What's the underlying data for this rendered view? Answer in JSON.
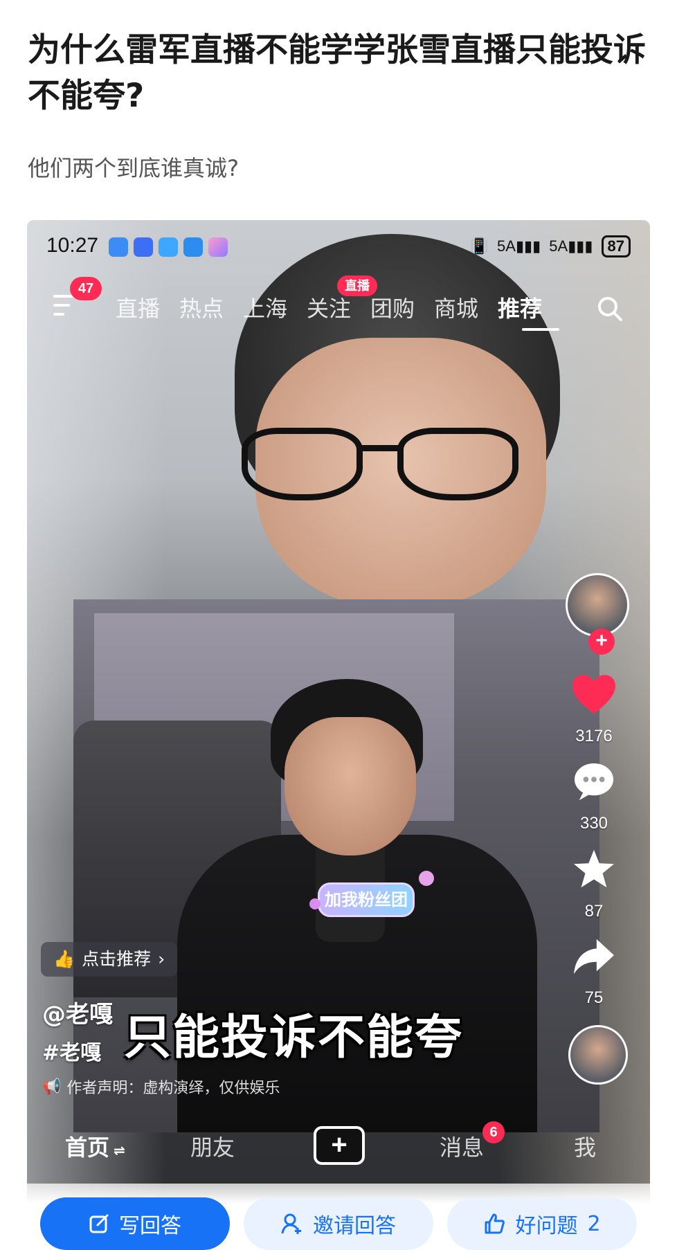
{
  "question": {
    "title": "为什么雷军直播不能学学张雪直播只能投诉不能夸?",
    "description": "他们两个到底谁真诚?"
  },
  "phone": {
    "status_bar": {
      "time": "10:27",
      "network": "5A",
      "battery": "87"
    },
    "top_nav": {
      "menu_badge": "47",
      "tabs": [
        {
          "label": "直播"
        },
        {
          "label": "热点"
        },
        {
          "label": "上海"
        },
        {
          "label": "关注",
          "badge": "直播"
        },
        {
          "label": "团购"
        },
        {
          "label": "商城"
        },
        {
          "label": "推荐",
          "active": true
        }
      ]
    },
    "fan_badge": "加我粉丝团",
    "actions": {
      "likes": "3176",
      "comments": "330",
      "favorites": "87",
      "shares": "75"
    },
    "recommend_pill": "点击推荐",
    "author": "@老嘎",
    "hashtag": "#老嘎",
    "disclaimer": "作者声明：虚构演绎，仅供娱乐",
    "subtitle": "只能投诉不能夸",
    "bottom_nav": [
      {
        "label": "首页",
        "suffix": "⇌",
        "active": true
      },
      {
        "label": "朋友"
      },
      {
        "label": "+"
      },
      {
        "label": "消息",
        "badge": "6"
      },
      {
        "label": "我"
      }
    ]
  },
  "action_bar": {
    "write_answer": "写回答",
    "invite_answer": "邀请回答",
    "good_question": "好问题",
    "good_question_count": "2"
  },
  "colors": {
    "brand": "#1772f6",
    "douyin_red": "#fe2c55",
    "like_red": "#fe2c55"
  }
}
